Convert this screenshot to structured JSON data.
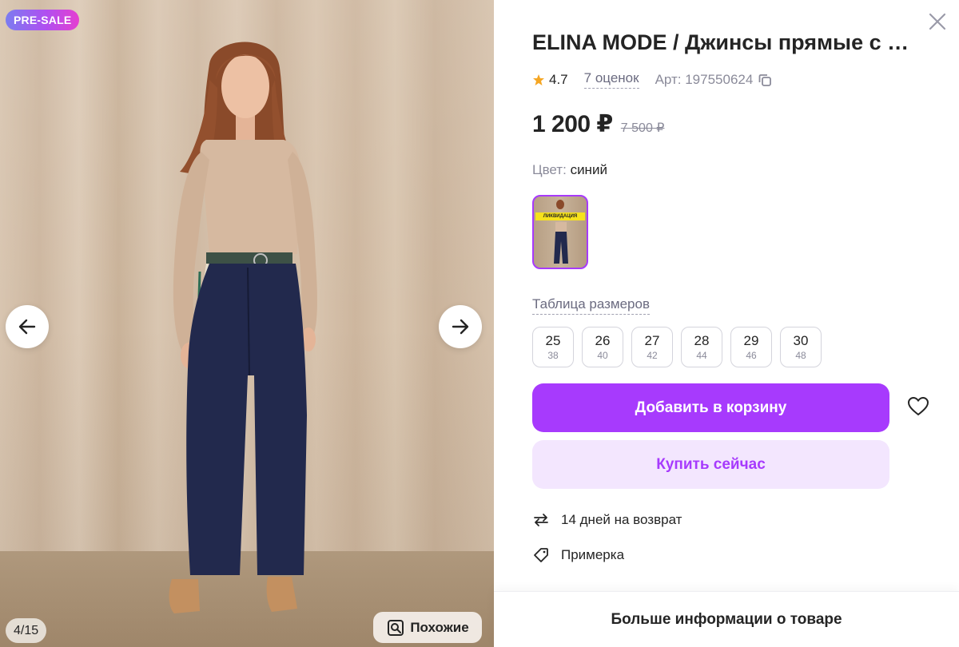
{
  "gallery": {
    "badge": "PRE-SALE",
    "counter": "4/15",
    "similar_label": "Похожие",
    "prev_icon": "arrow-left-icon",
    "next_icon": "arrow-right-icon"
  },
  "product": {
    "title": "ELINA MODE / Джинсы прямые с …",
    "rating": "4.7",
    "reviews": "7 оценок",
    "article": "Арт: 197550624",
    "price": "1 200 ₽",
    "old_price": "7 500 ₽",
    "color_label": "Цвет:",
    "color_value": "синий",
    "swatch_tag": "ЛИКВИДАЦИЯ",
    "size_table_label": "Таблица размеров",
    "sizes": [
      {
        "ru": "25",
        "eu": "38"
      },
      {
        "ru": "26",
        "eu": "40"
      },
      {
        "ru": "27",
        "eu": "42"
      },
      {
        "ru": "28",
        "eu": "44"
      },
      {
        "ru": "29",
        "eu": "46"
      },
      {
        "ru": "30",
        "eu": "48"
      }
    ]
  },
  "actions": {
    "add_to_cart": "Добавить в корзину",
    "buy_now": "Купить сейчас"
  },
  "features": {
    "return": "14 дней на возврат",
    "fitting": "Примерка"
  },
  "footer": {
    "more_info": "Больше информации о товаре"
  },
  "colors": {
    "accent": "#a73afd",
    "accent_light": "#f3e6fe",
    "star": "#f5a623"
  }
}
